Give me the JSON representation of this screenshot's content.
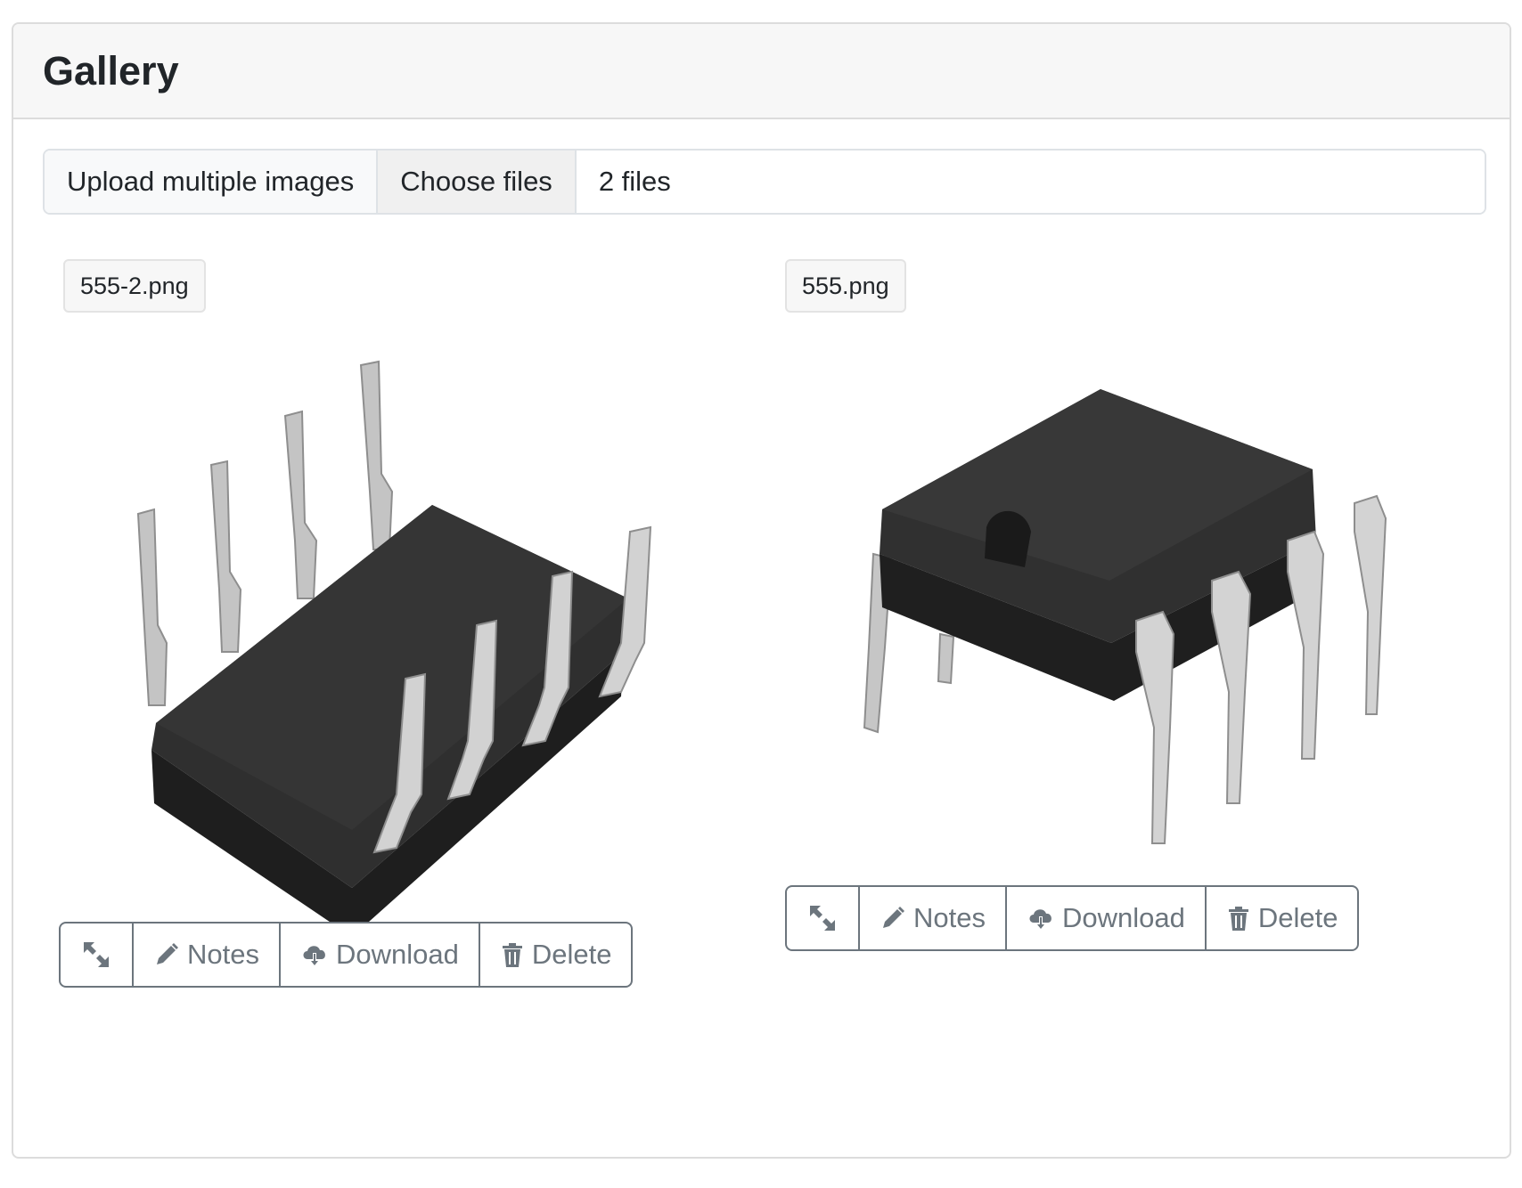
{
  "gallery": {
    "title": "Gallery",
    "upload": {
      "label": "Upload multiple images",
      "choose_label": "Choose files",
      "file_count": "2 files"
    },
    "items": [
      {
        "filename": "555-2.png",
        "actions": {
          "expand_icon": "expand-arrows-icon",
          "notes": "Notes",
          "download": "Download",
          "delete": "Delete"
        }
      },
      {
        "filename": "555.png",
        "actions": {
          "expand_icon": "expand-arrows-icon",
          "notes": "Notes",
          "download": "Download",
          "delete": "Delete"
        }
      }
    ]
  },
  "colors": {
    "button_text": "#6c757d",
    "chip_body": "#2b2b2b",
    "pin": "#c9c9c9"
  }
}
